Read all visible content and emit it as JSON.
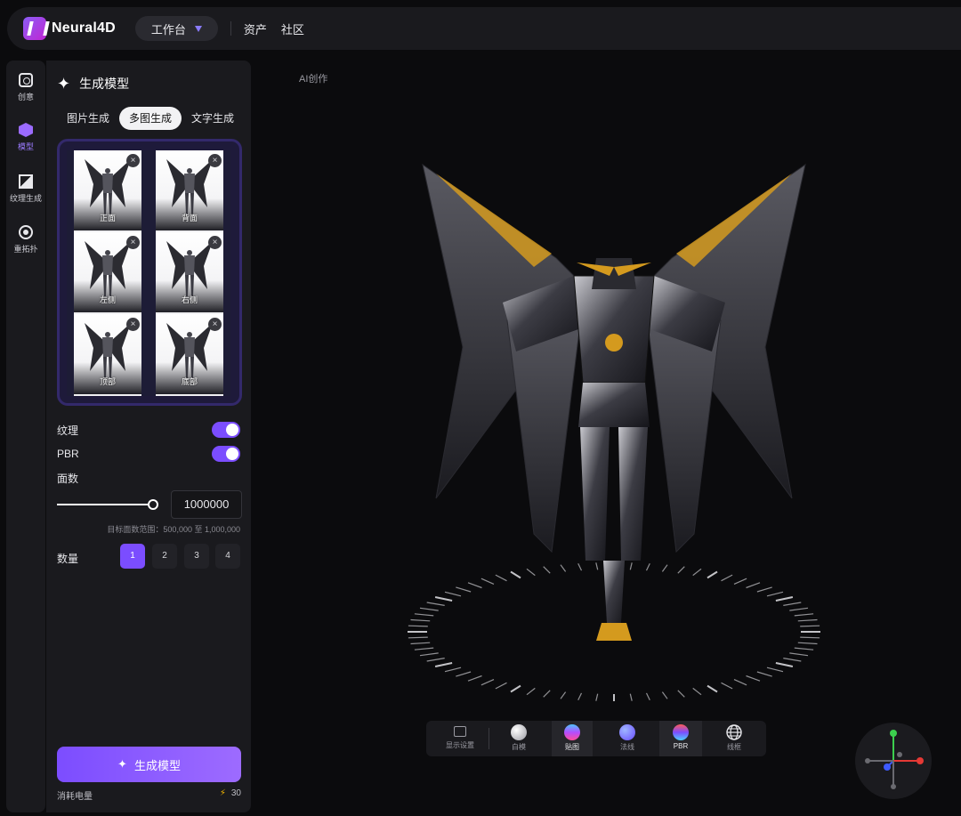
{
  "topbar": {
    "brand": "Neural4D",
    "workspace": "工作台",
    "nav": [
      "资产",
      "社区"
    ]
  },
  "rail": {
    "items": [
      {
        "label": "创意",
        "icon": "create-icon"
      },
      {
        "label": "模型",
        "icon": "model-cube-icon"
      },
      {
        "label": "纹理生成",
        "icon": "texture-icon"
      },
      {
        "label": "重拓扑",
        "icon": "retopology-icon"
      }
    ]
  },
  "panel": {
    "title": "生成模型",
    "tabs": [
      "图片生成",
      "多图生成",
      "文字生成"
    ],
    "active_tab": "多图生成",
    "views": [
      {
        "label": "正面"
      },
      {
        "label": "背面"
      },
      {
        "label": "左侧"
      },
      {
        "label": "右侧"
      },
      {
        "label": "顶部"
      },
      {
        "label": "底部"
      }
    ],
    "texture_label": "纹理",
    "texture_on": true,
    "pbr_label": "PBR",
    "pbr_on": true,
    "faces_label": "面数",
    "faces_value": "1000000",
    "faces_slider_fraction": 1.0,
    "faces_hint": "目标面数范围：500,000 至 1,000,000",
    "quantity_label": "数量",
    "quantity_options": [
      "1",
      "2",
      "3",
      "4"
    ],
    "quantity_selected": "1",
    "generate_label": "生成模型",
    "cost_label": "消耗电量",
    "cost_value": "30"
  },
  "viewport": {
    "label": "AI创作",
    "toolbar": [
      {
        "label": "显示设置",
        "icon": "display-settings-icon"
      },
      {
        "label": "白模",
        "icon": "white-model-icon"
      },
      {
        "label": "贴图",
        "icon": "texture-map-icon"
      },
      {
        "label": "法线",
        "icon": "normal-map-icon"
      },
      {
        "label": "PBR",
        "icon": "pbr-icon"
      },
      {
        "label": "线框",
        "icon": "wireframe-icon"
      }
    ]
  },
  "colors": {
    "accent": "#7b4dff",
    "panel_bg": "#1a1a1e",
    "page_bg": "#0b0b0d",
    "gold": "#d49a1e"
  }
}
